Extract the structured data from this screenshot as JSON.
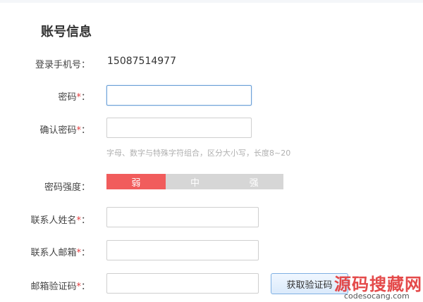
{
  "section_title": "账号信息",
  "phone": {
    "label": "登录手机号：",
    "value": "15087514977"
  },
  "password": {
    "label": "密码",
    "required_mark": "*",
    "colon": "：",
    "value": ""
  },
  "confirm_password": {
    "label": "确认密码",
    "required_mark": "*",
    "colon": "：",
    "value": ""
  },
  "password_hint": "字母、数字与特殊字符组合，区分大小写，长度8~20",
  "strength": {
    "label": "密码强度：",
    "levels": [
      "弱",
      "中",
      "强"
    ],
    "active_index": 0,
    "colors": {
      "active": "#f15c5c",
      "inactive": "#d6d6d6"
    }
  },
  "contact_name": {
    "label": "联系人姓名",
    "required_mark": "*",
    "colon": "：",
    "value": ""
  },
  "contact_email": {
    "label": "联系人邮箱",
    "required_mark": "*",
    "colon": "：",
    "value": ""
  },
  "email_code": {
    "label": "邮箱验证码",
    "required_mark": "*",
    "colon": "：",
    "value": "",
    "button_label": "获取验证码"
  },
  "watermark": {
    "main": "源码搜藏网",
    "sub": "codesocang.com"
  }
}
